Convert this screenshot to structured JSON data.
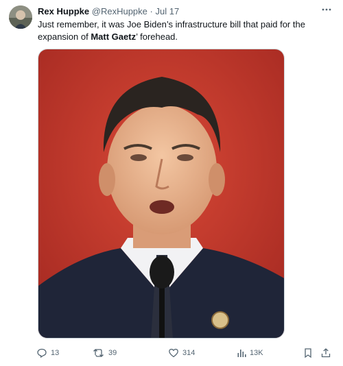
{
  "tweet": {
    "author_name": "Rex Huppke",
    "author_handle": "@RexHuppke",
    "separator": "·",
    "date": "Jul 17",
    "text_before": "Just remember, it was Joe Biden’s infrastructure bill that paid for the expansion of ",
    "text_bold": "Matt Gaetz",
    "text_after": "’ forehead.",
    "more_icon": "more-icon"
  },
  "actions": {
    "replies": "13",
    "retweets": "39",
    "likes": "314",
    "views": "13K"
  },
  "colors": {
    "text": "#0f1419",
    "muted": "#536471",
    "media_bg": "#c23a2f"
  }
}
